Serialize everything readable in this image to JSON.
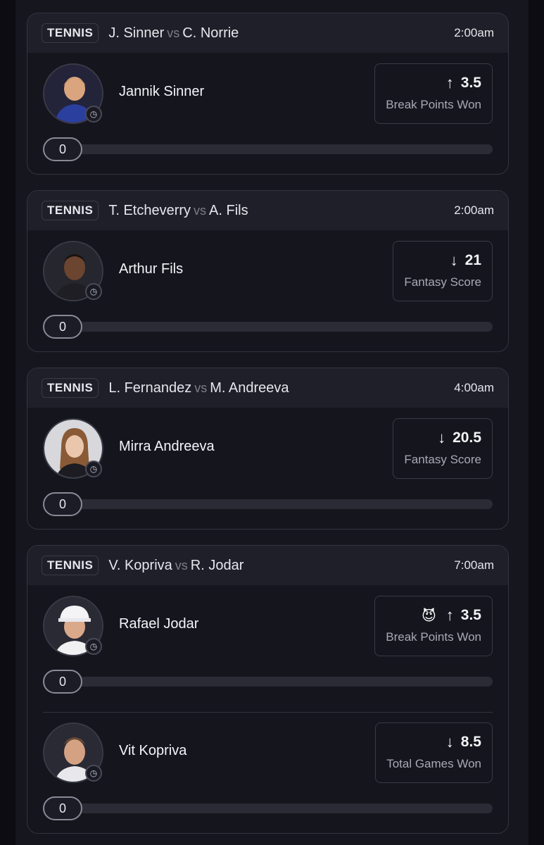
{
  "cards": [
    {
      "sport": "TENNIS",
      "player1": "J. Sinner",
      "vs": "vs",
      "player2": "C. Norrie",
      "time": "2:00am",
      "picks": [
        {
          "name": "Jannik Sinner",
          "direction": "up",
          "arrow": "↑",
          "value": "3.5",
          "stat": "Break Points Won",
          "progress": "0",
          "progress_fraction": 0
        }
      ]
    },
    {
      "sport": "TENNIS",
      "player1": "T. Etcheverry",
      "vs": "vs",
      "player2": "A. Fils",
      "time": "2:00am",
      "picks": [
        {
          "name": "Arthur Fils",
          "direction": "down",
          "arrow": "↓",
          "value": "21",
          "stat": "Fantasy Score",
          "progress": "0",
          "progress_fraction": 0
        }
      ]
    },
    {
      "sport": "TENNIS",
      "player1": "L. Fernandez",
      "vs": "vs",
      "player2": "M. Andreeva",
      "time": "4:00am",
      "picks": [
        {
          "name": "Mirra Andreeva",
          "direction": "down",
          "arrow": "↓",
          "value": "20.5",
          "stat": "Fantasy Score",
          "progress": "0",
          "progress_fraction": 0
        }
      ]
    },
    {
      "sport": "TENNIS",
      "player1": "V. Kopriva",
      "vs": "vs",
      "player2": "R. Jodar",
      "time": "7:00am",
      "picks": [
        {
          "name": "Rafael Jodar",
          "direction": "up",
          "arrow": "↑",
          "value": "3.5",
          "stat": "Break Points Won",
          "progress": "0",
          "progress_fraction": 0,
          "badge_icon": "demon-icon"
        },
        {
          "name": "Vit Kopriva",
          "direction": "down",
          "arrow": "↓",
          "value": "8.5",
          "stat": "Total Games Won",
          "progress": "0",
          "progress_fraction": 0
        }
      ]
    }
  ],
  "icons": {
    "clock": "clock-icon",
    "up": "arrow-up-icon",
    "down": "arrow-down-icon"
  },
  "colors": {
    "background": "#16161e",
    "card": "#15151e",
    "card_header": "#1f1f29",
    "track": "#2b2b36",
    "muted_text": "#a9a9b5"
  }
}
